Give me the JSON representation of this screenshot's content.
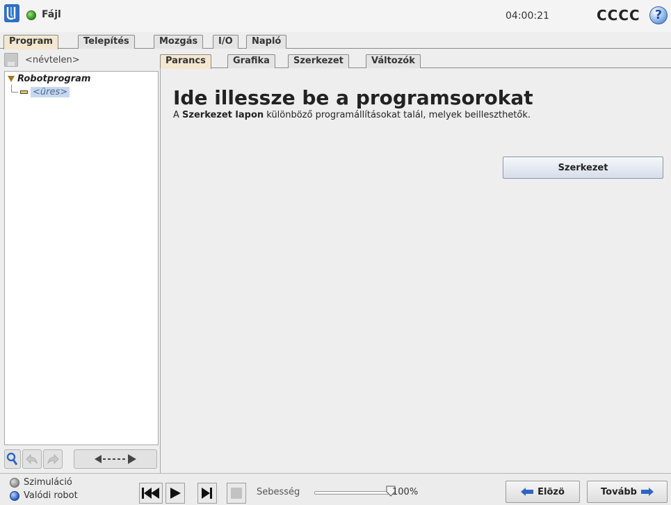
{
  "header": {
    "file_menu": "Fájl",
    "clock": "04:00:21",
    "robot_name": "CCCC",
    "help": "?"
  },
  "main_tabs": [
    "Program",
    "Telepítés",
    "Mozgás",
    "I/O",
    "Napló"
  ],
  "active_main_tab": "Program",
  "left_panel": {
    "program_name": "<névtelen>",
    "tree": {
      "root": "Robotprogram",
      "child": "<üres>"
    }
  },
  "sub_tabs": [
    "Parancs",
    "Grafika",
    "Szerkezet",
    "Változók"
  ],
  "active_sub_tab": "Parancs",
  "content": {
    "title": "Ide illessze be a programsorokat",
    "desc_prefix": "A ",
    "desc_bold": "Szerkezet lapon",
    "desc_suffix": " különböző programállításokat talál, melyek beilleszthetők.",
    "structure_button": "Szerkezet"
  },
  "bottom": {
    "mode_simulation": "Szimuláció",
    "mode_real": "Valódi robot",
    "speed_label": "Sebesség",
    "speed_value": "100%",
    "speed_fraction": 1.0,
    "prev_button": "Elözö",
    "next_button": "Tovább"
  },
  "colors": {
    "active_tab": "#f3e7cf",
    "status_ok": "#2e8b1e",
    "tree_selection": "#c9d8ee",
    "nav_arrow": "#2f64c6"
  }
}
